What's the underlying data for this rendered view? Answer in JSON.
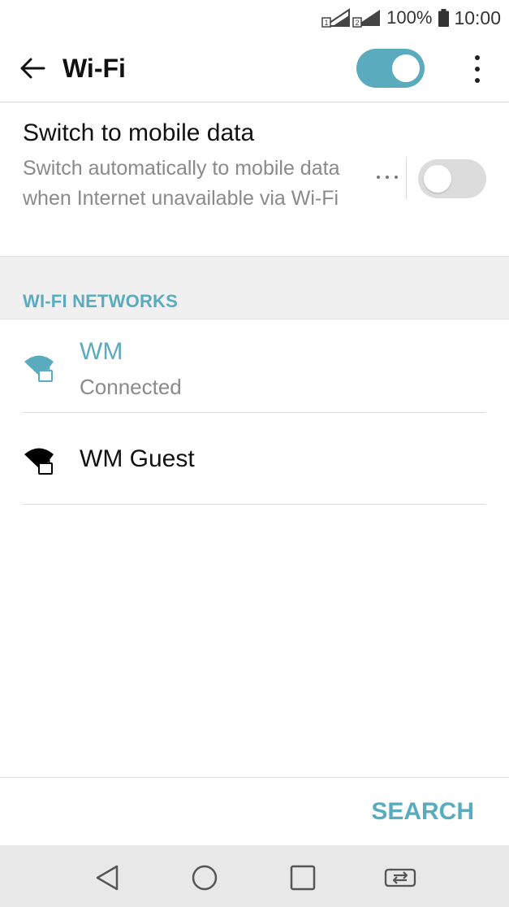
{
  "status_bar": {
    "sim1_label": "1",
    "sim2_label": "2",
    "battery": "100%",
    "time": "10:00"
  },
  "app_bar": {
    "title": "Wi-Fi",
    "wifi_enabled": true
  },
  "mobile_data": {
    "title": "Switch to mobile data",
    "description": "Switch automatically to mobile data when Internet unavailable via Wi-Fi",
    "enabled": false
  },
  "networks": {
    "header": "WI-FI NETWORKS",
    "items": [
      {
        "name": "WM",
        "status": "Connected",
        "secured": true,
        "connected": true,
        "color": "#5aabbd"
      },
      {
        "name": "WM Guest",
        "status": "",
        "secured": true,
        "connected": false,
        "color": "#000000"
      }
    ]
  },
  "actions": {
    "search_label": "SEARCH"
  },
  "colors": {
    "accent": "#5aabbd",
    "toggle_off": "#dcdcdc",
    "secondary_text": "#8a8a8a"
  },
  "icons": {
    "back": "arrow-left-icon",
    "overflow": "more-vert-icon",
    "nav_back": "triangle-back-icon",
    "nav_home": "circle-home-icon",
    "nav_recents": "square-recents-icon",
    "nav_switch": "sim-switch-icon"
  }
}
